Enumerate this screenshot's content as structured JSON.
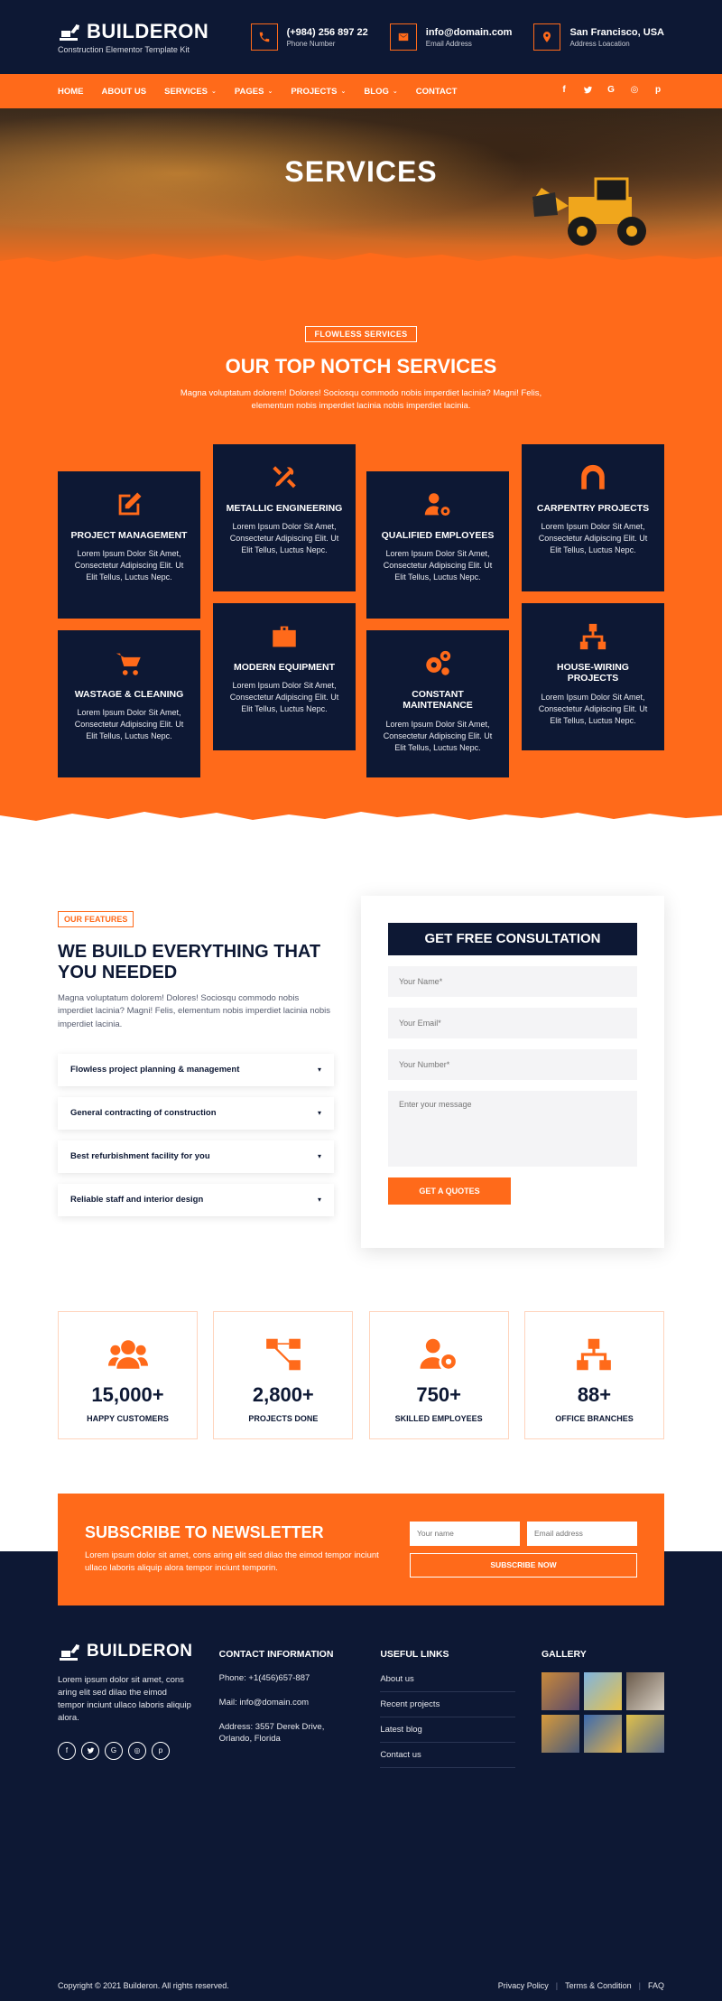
{
  "brand": {
    "name": "BUILDERON",
    "tagline": "Construction Elementor Template Kit"
  },
  "contacts": [
    {
      "icon": "phone-icon",
      "main": "(+984) 256 897 22",
      "sub": "Phone Number"
    },
    {
      "icon": "mail-icon",
      "main": "info@domain.com",
      "sub": "Email Address"
    },
    {
      "icon": "location-pin-icon",
      "main": "San Francisco, USA",
      "sub": "Address Loacation"
    }
  ],
  "nav": {
    "items": [
      "HOME",
      "ABOUT US",
      "SERVICES",
      "PAGES",
      "PROJECTS",
      "BLOG",
      "CONTACT"
    ],
    "dropdown": [
      false,
      false,
      true,
      true,
      true,
      true,
      false
    ],
    "socials": [
      "f",
      "t",
      "G",
      "◎",
      "p"
    ]
  },
  "hero": {
    "title": "SERVICES"
  },
  "services": {
    "tag": "FLOWLESS SERVICES",
    "title": "OUR TOP NOTCH SERVICES",
    "description": "Magna voluptatum dolorem! Dolores! Sociosqu commodo nobis imperdiet lacinia? Magni! Felis, elementum nobis imperdiet lacinia nobis imperdiet lacinia.",
    "cards": [
      {
        "title": "PROJECT MANAGEMENT",
        "desc": "Lorem Ipsum Dolor Sit Amet, Consectetur Adipiscing Elit. Ut Elit Tellus, Luctus Nepc.",
        "icon": "edit-icon"
      },
      {
        "title": "METALLIC ENGINEERING",
        "desc": "Lorem Ipsum Dolor Sit Amet, Consectetur Adipiscing Elit. Ut Elit Tellus, Luctus Nepc.",
        "icon": "tools-icon"
      },
      {
        "title": "QUALIFIED EMPLOYEES",
        "desc": "Lorem Ipsum Dolor Sit Amet, Consectetur Adipiscing Elit. Ut Elit Tellus, Luctus Nepc.",
        "icon": "user-gear-icon"
      },
      {
        "title": "CARPENTRY PROJECTS",
        "desc": "Lorem Ipsum Dolor Sit Amet, Consectetur Adipiscing Elit. Ut Elit Tellus, Luctus Nepc.",
        "icon": "archway-icon"
      },
      {
        "title": "WASTAGE & CLEANING",
        "desc": "Lorem Ipsum Dolor Sit Amet, Consectetur Adipiscing Elit. Ut Elit Tellus, Luctus Nepc.",
        "icon": "cart-icon"
      },
      {
        "title": "MODERN EQUIPMENT",
        "desc": "Lorem Ipsum Dolor Sit Amet, Consectetur Adipiscing Elit. Ut Elit Tellus, Luctus Nepc.",
        "icon": "toolbox-icon"
      },
      {
        "title": "CONSTANT MAINTENANCE",
        "desc": "Lorem Ipsum Dolor Sit Amet, Consectetur Adipiscing Elit. Ut Elit Tellus, Luctus Nepc.",
        "icon": "gears-icon"
      },
      {
        "title": "HOUSE-WIRING PROJECTS",
        "desc": "Lorem Ipsum Dolor Sit Amet, Consectetur Adipiscing Elit. Ut Elit Tellus, Luctus Nepc.",
        "icon": "network-icon"
      }
    ]
  },
  "features": {
    "tag": "OUR FEATURES",
    "title": "WE BUILD EVERYTHING THAT YOU NEEDED",
    "description": "Magna voluptatum dolorem! Dolores! Sociosqu commodo nobis imperdiet lacinia? Magni! Felis, elementum nobis imperdiet lacinia nobis imperdiet lacinia.",
    "accordion": [
      "Flowless project planning & management",
      "General contracting of construction",
      "Best refurbishment facility for you",
      "Reliable staff and interior design"
    ]
  },
  "form": {
    "title": "GET FREE CONSULTATION",
    "name_placeholder": "Your Name*",
    "email_placeholder": "Your Email*",
    "number_placeholder": "Your Number*",
    "message_placeholder": "Enter your message",
    "submit": "GET A QUOTES"
  },
  "stats": [
    {
      "num": "15,000+",
      "label": "HAPPY CUSTOMERS",
      "icon": "users-icon"
    },
    {
      "num": "2,800+",
      "label": "PROJECTS DONE",
      "icon": "flow-icon"
    },
    {
      "num": "750+",
      "label": "SKILLED EMPLOYEES",
      "icon": "user-gear-icon"
    },
    {
      "num": "88+",
      "label": "OFFICE BRANCHES",
      "icon": "network-icon"
    }
  ],
  "newsletter": {
    "title": "SUBSCRIBE TO NEWSLETTER",
    "description": "Lorem ipsum dolor sit amet, cons aring elit sed dilao the eimod tempor inciunt ullaco laboris aliquip alora tempor inciunt temporin.",
    "name_placeholder": "Your name",
    "email_placeholder": "Email address",
    "button": "SUBSCRIBE NOW"
  },
  "footer": {
    "about": "Lorem ipsum dolor sit amet, cons aring elit sed dilao the eimod tempor inciunt ullaco laboris aliquip alora.",
    "socials": [
      "f",
      "t",
      "G",
      "◎",
      "p"
    ],
    "contact_heading": "CONTACT INFORMATION",
    "phone": "Phone: +1(456)657-887",
    "mail": "Mail: info@domain.com",
    "address": "Address: 3557 Derek Drive, Orlando, Florida",
    "links_heading": "USEFUL LINKS",
    "links": [
      "About us",
      "Recent projects",
      "Latest blog",
      "Contact us"
    ],
    "gallery_heading": "GALLERY",
    "copyright": "Copyright © 2021 Builderon. All rights reserved.",
    "legal": [
      "Privacy Policy",
      "Terms & Condition",
      "FAQ"
    ]
  },
  "colors": {
    "accent": "#ff6a1a",
    "navy": "#0d1834"
  }
}
